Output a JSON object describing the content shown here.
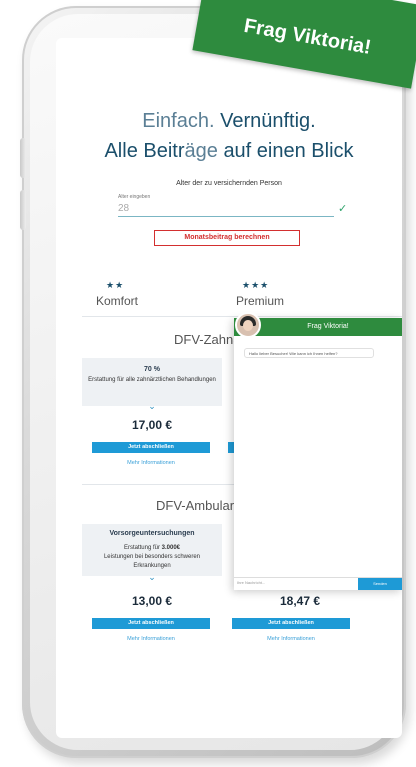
{
  "badge": {
    "text": "Frag Viktoria!"
  },
  "headline": {
    "line1_light": "Einfach. ",
    "line1_bold": "Vernünftig.",
    "line2_a": "Alle Beitr",
    "line2_b": "äge ",
    "line2_c": "auf einen Blick"
  },
  "age_form": {
    "title": "Alter der zu versichernden Person",
    "field_label": "Alter eingeben",
    "value": "28",
    "calc_button": "Monatsbeitrag berechnen"
  },
  "tiers": [
    {
      "stars": "★★",
      "name": "Komfort"
    },
    {
      "stars": "★★★",
      "name": "Premium"
    }
  ],
  "sections": {
    "zahn": {
      "title": "DFV-ZahnS",
      "percent": "70 %",
      "description": "Erstattung für alle zahnärztlichen Behandlungen",
      "price_left": "17,00 €",
      "button": "Jetzt abschließen",
      "more": "Mehr Informationen"
    },
    "ambulant": {
      "title": "DFV-Ambular",
      "subtitle": "Vorsorgeuntersuchungen",
      "description_a": "Erstattung für ",
      "description_bold": "3.000€",
      "description_b": "Leistungen bei besonders schweren Erkrankungen",
      "price_left": "13,00 €",
      "price_right": "18,47 €",
      "button_left": "Jetzt abschließen",
      "button_right": "Jetzt abschließen",
      "more_left": "Mehr Informationen",
      "more_right": "Mehr Informationen"
    }
  },
  "chat": {
    "title": "Frag Viktoria!",
    "message": "Hallo lieber Besucher! Wie kann ich Ihnen helfen?",
    "input_placeholder": "Ihre Nachricht...",
    "send_label": "Senden"
  },
  "colors": {
    "brand_green": "#2e8b3e",
    "accent_blue": "#1e9ad6",
    "headline_blue": "#1b4f6b",
    "calc_red": "#d32f2f"
  }
}
